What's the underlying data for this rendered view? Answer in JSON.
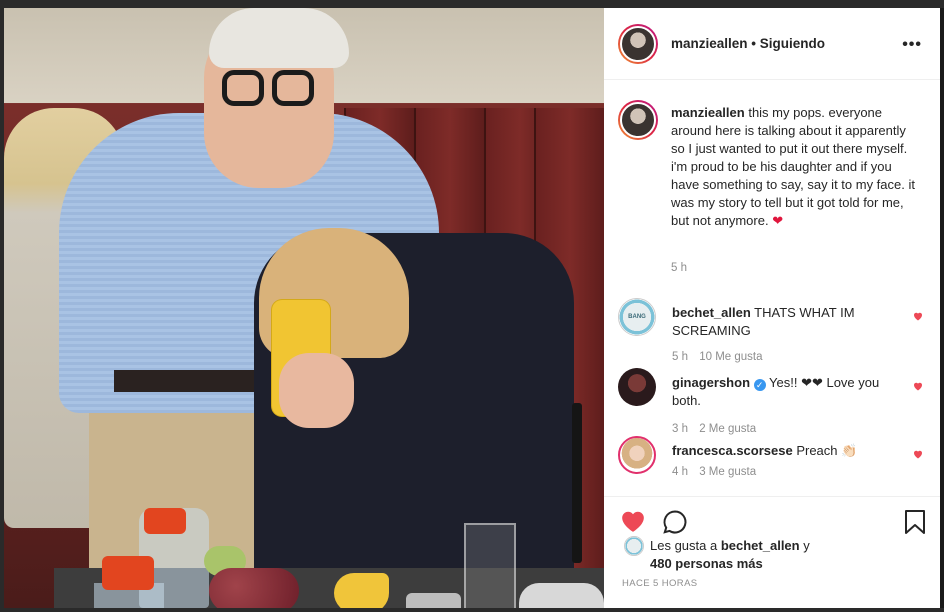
{
  "header": {
    "username": "manzieallen",
    "separator": "•",
    "follow_state": "Siguiendo",
    "more_icon": "more-horizontal-icon",
    "more_label": "•••"
  },
  "caption": {
    "username": "manzieallen",
    "text": "this my pops. everyone around here is talking about it apparently so I just wanted to put it out there myself. i'm proud to be his daughter and if you have something to say, say it to my face. it was my story to tell but it got told for me, but not anymore.",
    "emoji": "❤",
    "time": "5 h"
  },
  "comments": [
    {
      "username": "bechet_allen",
      "text": "THATS WHAT IM SCREAMING",
      "time": "5 h",
      "likes": "10 Me gusta",
      "avatar_label": "BANG"
    },
    {
      "username": "ginagershon",
      "verified": "✓",
      "text": "Yes!! ❤❤ Love you both.",
      "time": "3 h",
      "likes": "2 Me gusta"
    },
    {
      "username": "francesca.scorsese",
      "text": "Preach 👏🏻",
      "time": "4 h",
      "likes": "3 Me gusta"
    }
  ],
  "actions": {
    "like_icon": "heart-filled-icon",
    "comment_icon": "comment-icon",
    "save_icon": "bookmark-icon"
  },
  "likes": {
    "prefix": "Les gusta a",
    "user": "bechet_allen",
    "suffix": "y",
    "others": "480 personas más"
  },
  "posted": "HACE 5 HORAS",
  "colors": {
    "like_red": "#ed4956",
    "text": "#262626",
    "muted": "#8e8e8e",
    "verified_blue": "#3897f0"
  }
}
